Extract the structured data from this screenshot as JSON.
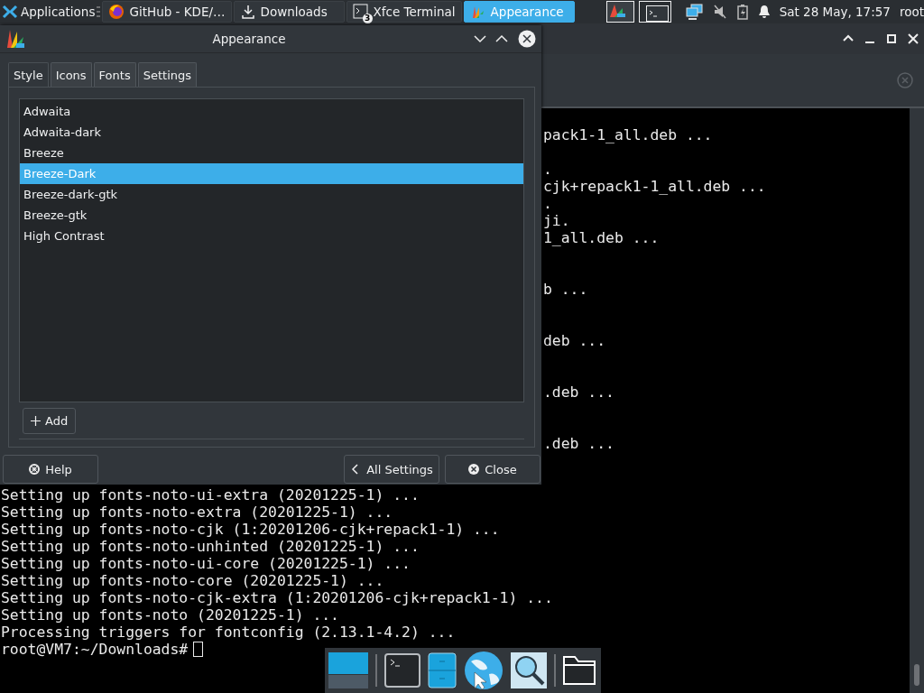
{
  "panel": {
    "menu": {
      "label": "Applications"
    },
    "tasks": [
      {
        "label": "GitHub - KDE/…",
        "kind": "browser",
        "selected": false
      },
      {
        "label": "Downloads",
        "kind": "download",
        "selected": false
      },
      {
        "label": "Xfce Terminal",
        "kind": "terminal",
        "badge": "3",
        "selected": false
      },
      {
        "label": "Appearance",
        "kind": "appearance",
        "selected": true
      }
    ],
    "clock": "Sat 28 May, 17:57",
    "user": "root"
  },
  "dialog": {
    "title": "Appearance",
    "tabs": [
      {
        "label": "Style",
        "selected": true
      },
      {
        "label": "Icons",
        "selected": false
      },
      {
        "label": "Fonts",
        "selected": false
      },
      {
        "label": "Settings",
        "selected": false
      }
    ],
    "themes": [
      {
        "label": "Adwaita",
        "selected": false
      },
      {
        "label": "Adwaita-dark",
        "selected": false
      },
      {
        "label": "Breeze",
        "selected": false
      },
      {
        "label": "Breeze-Dark",
        "selected": true
      },
      {
        "label": "Breeze-dark-gtk",
        "selected": false
      },
      {
        "label": "Breeze-gtk",
        "selected": false
      },
      {
        "label": "High Contrast",
        "selected": false
      }
    ],
    "add_button": "Add",
    "buttons": [
      {
        "label": "Help",
        "kind": "help"
      },
      {
        "label": "All Settings",
        "kind": "back"
      },
      {
        "label": "Close",
        "kind": "close"
      }
    ]
  },
  "terminal": {
    "lines": [
      {
        "text": "pack1-1_all.deb ...",
        "kind": "partial"
      },
      {
        "text": ".",
        "kind": "partial"
      },
      {
        "text": "cjk+repack1-1_all.deb ...",
        "kind": "partial"
      },
      {
        "text": ".",
        "kind": "partial"
      },
      {
        "text": "ji.",
        "kind": "partial"
      },
      {
        "text": "1_all.deb ...",
        "kind": "partial"
      },
      {
        "text": "b ...",
        "kind": "partial"
      },
      {
        "text": "deb ...",
        "kind": "partial"
      },
      {
        "text": ".deb ...",
        "kind": "partial"
      },
      {
        "text": ".deb ...",
        "kind": "partial"
      },
      {
        "text": "Setting up fonts-noto-ui-extra (20201225-1) ...",
        "kind": "full"
      },
      {
        "text": "Setting up fonts-noto-extra (20201225-1) ...",
        "kind": "full"
      },
      {
        "text": "Setting up fonts-noto-cjk (1:20201206-cjk+repack1-1) ...",
        "kind": "full"
      },
      {
        "text": "Setting up fonts-noto-unhinted (20201225-1) ...",
        "kind": "full"
      },
      {
        "text": "Setting up fonts-noto-ui-core (20201225-1) ...",
        "kind": "full"
      },
      {
        "text": "Setting up fonts-noto-core (20201225-1) ...",
        "kind": "full"
      },
      {
        "text": "Setting up fonts-noto-cjk-extra (1:20201206-cjk+repack1-1) ...",
        "kind": "full"
      },
      {
        "text": "Setting up fonts-noto (20201225-1) ...",
        "kind": "full"
      },
      {
        "text": "Processing triggers for fontconfig (2.13.1-4.2) ...",
        "kind": "full"
      },
      {
        "text": "root@VM7:~/Downloads#",
        "kind": "prompt"
      }
    ]
  }
}
